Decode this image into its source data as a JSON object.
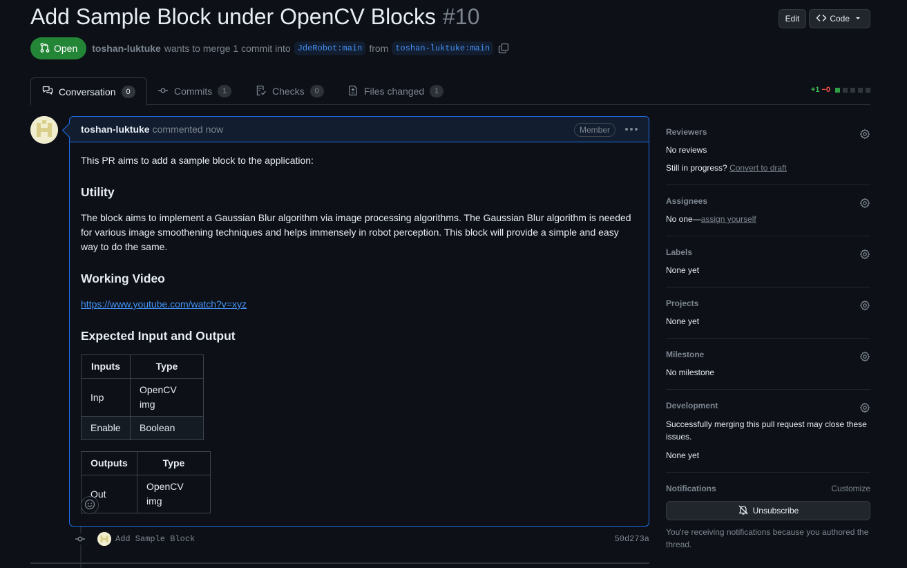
{
  "pr": {
    "title": "Add Sample Block under OpenCV Blocks",
    "number": "#10",
    "state": "Open",
    "author": "toshan-luktuke",
    "merge_text": "wants to merge 1 commit into",
    "base_branch": "JdeRobot:main",
    "from_text": "from",
    "head_branch": "toshan-luktuke:main"
  },
  "header": {
    "edit_label": "Edit",
    "code_label": "Code"
  },
  "tabs": [
    {
      "label": "Conversation",
      "count": "0",
      "icon": "comment-discussion-icon"
    },
    {
      "label": "Commits",
      "count": "1",
      "icon": "git-commit-icon"
    },
    {
      "label": "Checks",
      "count": "0",
      "icon": "checklist-icon"
    },
    {
      "label": "Files changed",
      "count": "1",
      "icon": "file-diff-icon"
    }
  ],
  "diffstat": {
    "additions": "+1",
    "deletions": "−0"
  },
  "comment": {
    "author": "toshan-luktuke",
    "time": "commented now",
    "role": "Member",
    "intro": "This PR aims to add a sample block to the application:",
    "h_utility": "Utility",
    "utility": "The block aims to implement a Gaussian Blur algorithm via image processing algorithms. The Gaussian Blur algorithm is needed for various image smoothening techniques and helps immensely in robot perception. This block will provide a simple and easy way to do the same.",
    "h_video": "Working Video",
    "video_link": "https://www.youtube.com/watch?v=xyz",
    "h_io": "Expected Input and Output",
    "inputs_table": {
      "headers": [
        "Inputs",
        "Type"
      ],
      "rows": [
        [
          "Inp",
          "OpenCV img"
        ],
        [
          "Enable",
          "Boolean"
        ]
      ]
    },
    "outputs_table": {
      "headers": [
        "Outputs",
        "Type"
      ],
      "rows": [
        [
          "Out",
          "OpenCV img"
        ]
      ]
    }
  },
  "commit": {
    "message": "Add Sample Block",
    "sha": "50d273a"
  },
  "sidebar": {
    "reviewers": {
      "title": "Reviewers",
      "value": "No reviews",
      "progress": "Still in progress?",
      "draft_link": "Convert to draft"
    },
    "assignees": {
      "title": "Assignees",
      "value": "No one—",
      "assign_link": "assign yourself"
    },
    "labels": {
      "title": "Labels",
      "value": "None yet"
    },
    "projects": {
      "title": "Projects",
      "value": "None yet"
    },
    "milestone": {
      "title": "Milestone",
      "value": "No milestone"
    },
    "development": {
      "title": "Development",
      "note": "Successfully merging this pull request may close these issues.",
      "value": "None yet"
    },
    "notifications": {
      "title": "Notifications",
      "customize": "Customize",
      "unsubscribe": "Unsubscribe",
      "notice": "You're receiving notifications because you authored the thread."
    }
  },
  "colors": {
    "open_green": "#238636",
    "link_blue": "#4493f8",
    "border_blue": "#1f6feb",
    "bg": "#0d1117"
  }
}
